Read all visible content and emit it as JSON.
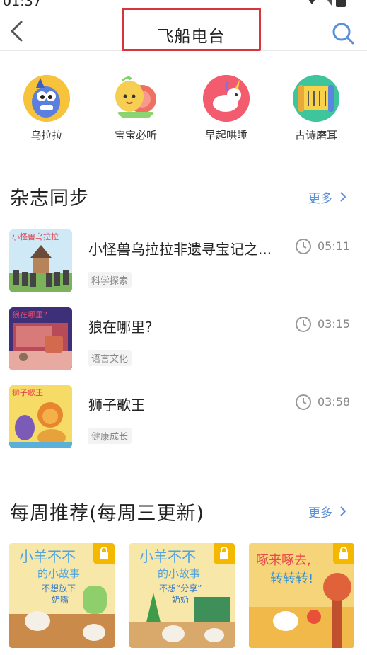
{
  "status": {
    "time": "01:37"
  },
  "header": {
    "title": "飞船电台"
  },
  "categories": [
    {
      "label": "乌拉拉",
      "icon": "monster-icon"
    },
    {
      "label": "宝宝必听",
      "icon": "snail-icon"
    },
    {
      "label": "早起哄睡",
      "icon": "unicorn-icon"
    },
    {
      "label": "古诗磨耳",
      "icon": "scroll-icon"
    }
  ],
  "magazine": {
    "title": "杂志同步",
    "more": "更多",
    "items": [
      {
        "title": "小怪兽乌拉拉非遗寻宝记之...",
        "tag": "科学探索",
        "duration": "05:11",
        "cover_text": "小怪兽乌拉拉"
      },
      {
        "title": "狼在哪里?",
        "tag": "语言文化",
        "duration": "03:15",
        "cover_text": "狼在哪里?"
      },
      {
        "title": "狮子歌王",
        "tag": "健康成长",
        "duration": "03:58",
        "cover_text": "狮子歌王"
      }
    ]
  },
  "weekly": {
    "title": "每周推荐(每周三更新)",
    "more": "更多",
    "cards": [
      {
        "line1": "小羊不不",
        "line2": "的小故事",
        "line3": "不想放下",
        "line4": "奶嘴"
      },
      {
        "line1": "小羊不不",
        "line2": "的小故事",
        "line3": "不想“分享”",
        "line4": "奶奶"
      },
      {
        "line1": "啄来啄去,",
        "line2": "转转转!",
        "line3": "",
        "line4": ""
      }
    ]
  },
  "colors": {
    "accent": "#5b8fd8",
    "highlight_border": "#d8343a",
    "lock": "#f5b800"
  }
}
